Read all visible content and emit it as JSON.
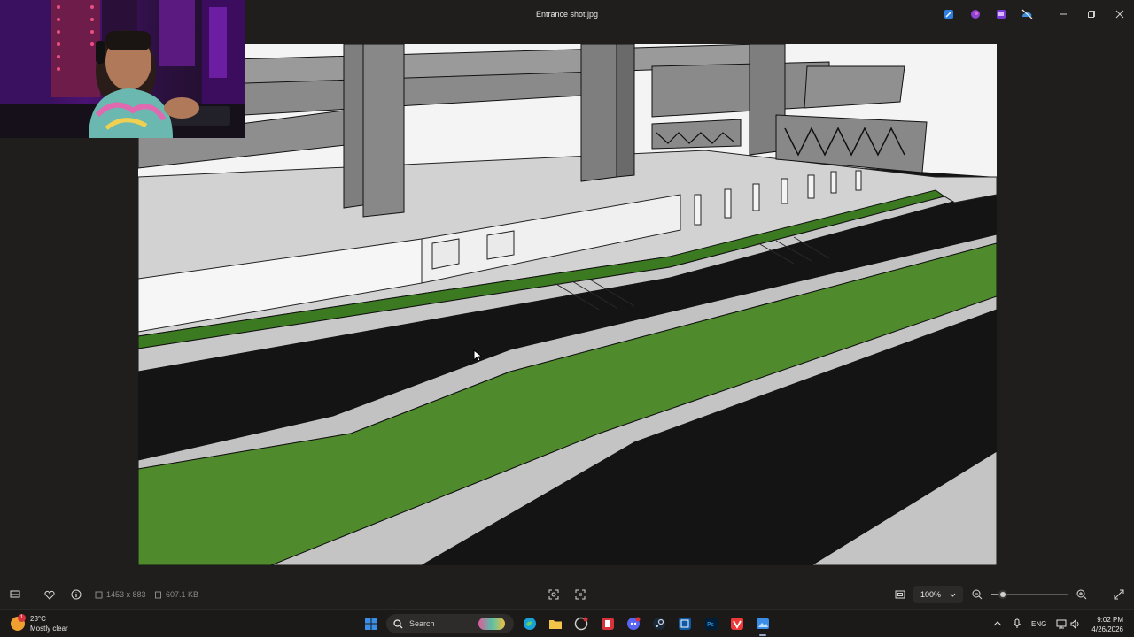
{
  "window": {
    "title": "Entrance shot.jpg"
  },
  "viewer": {
    "dimensions": "1453 x 883",
    "file_size": "607.1 KB",
    "zoom": "100%",
    "zoom_level_fraction": 0.15
  },
  "taskbar": {
    "weather_temp": "23°C",
    "weather_desc": "Mostly clear",
    "weather_badge": "1",
    "search_placeholder": "Search",
    "language": "ENG",
    "time": "9:02 PM",
    "date": "4/26/2026",
    "pinned_apps": [
      "start",
      "search",
      "edge",
      "file-explorer",
      "app-circle",
      "red-app",
      "discord",
      "steam",
      "blue-app",
      "photoshop",
      "vivaldi",
      "photos"
    ]
  },
  "colors": {
    "accent": "#3b8ee8",
    "grass": "#4f8a2c",
    "asphalt": "#141414",
    "concrete": "#c8c8c8"
  }
}
